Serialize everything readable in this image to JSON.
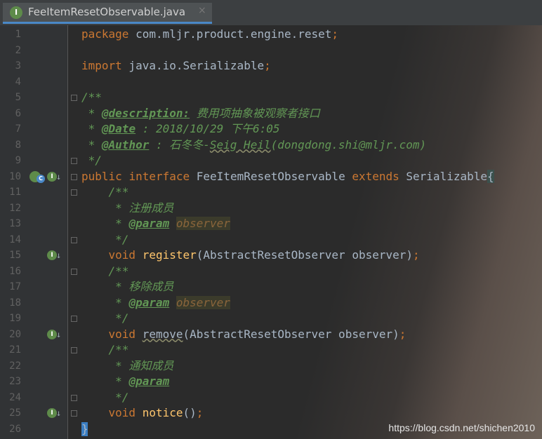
{
  "tab": {
    "icon": "I",
    "title": "FeeItemResetObservable.java",
    "close": "×"
  },
  "lines": {
    "1": {
      "n": "1",
      "kw": "package",
      "rest": " com.mljr.product.engine.reset",
      "sem": ";"
    },
    "2": {
      "n": "2"
    },
    "3": {
      "n": "3",
      "kw": "import",
      "rest": " java.io.Serializable",
      "sem": ";"
    },
    "4": {
      "n": "4"
    },
    "5": {
      "n": "5",
      "text": "/**"
    },
    "6": {
      "n": "6",
      "pre": " * ",
      "tag": "@description:",
      "text": " 费用项抽象被观察者接口"
    },
    "7": {
      "n": "7",
      "pre": " * ",
      "tag": "@Date",
      "text": " : 2018/10/29 下午6:05"
    },
    "8": {
      "n": "8",
      "pre": " * ",
      "tag": "@Author",
      "text": " : 石冬冬-",
      "wavy": "Seig Heil",
      "text2": "(dongdong.shi@mljr.com)"
    },
    "9": {
      "n": "9",
      "text": " */"
    },
    "10": {
      "n": "10",
      "kw1": "public",
      "kw2": "interface",
      "name": " FeeItemResetObservable ",
      "kw3": "extends",
      "rest": " Serializable",
      "brace": "{"
    },
    "11": {
      "n": "11",
      "text": "    /**"
    },
    "12": {
      "n": "12",
      "text": "     * 注册成员"
    },
    "13": {
      "n": "13",
      "pre": "     * ",
      "tag": "@param",
      "param": "observer"
    },
    "14": {
      "n": "14",
      "text": "     */"
    },
    "15": {
      "n": "15",
      "kw": "    void ",
      "fn": "register",
      "rest": "(AbstractResetObserver observer)",
      "sem": ";"
    },
    "16": {
      "n": "16",
      "text": "    /**"
    },
    "17": {
      "n": "17",
      "text": "     * 移除成员"
    },
    "18": {
      "n": "18",
      "pre": "     * ",
      "tag": "@param",
      "param": "observer"
    },
    "19": {
      "n": "19",
      "text": "     */"
    },
    "20": {
      "n": "20",
      "kw": "    void ",
      "fn": "remove",
      "rest": "(AbstractResetObserver observer)",
      "sem": ";"
    },
    "21": {
      "n": "21",
      "text": "    /**"
    },
    "22": {
      "n": "22",
      "text": "     * 通知成员"
    },
    "23": {
      "n": "23",
      "pre": "     * ",
      "tag": "@param"
    },
    "24": {
      "n": "24",
      "text": "     */"
    },
    "25": {
      "n": "25",
      "kw": "    void ",
      "fn": "notice",
      "rest": "()",
      "sem": ";"
    },
    "26": {
      "n": "26",
      "text": "}"
    }
  },
  "gutter_icons": {
    "implemented": "I",
    "hierarchy": "C",
    "arrow": "↓"
  },
  "watermark": "https://blog.csdn.net/shichen2010",
  "colors": {
    "keyword": "#cc7832",
    "comment": "#629755",
    "function": "#ffc66d",
    "text": "#a9b7c6"
  }
}
